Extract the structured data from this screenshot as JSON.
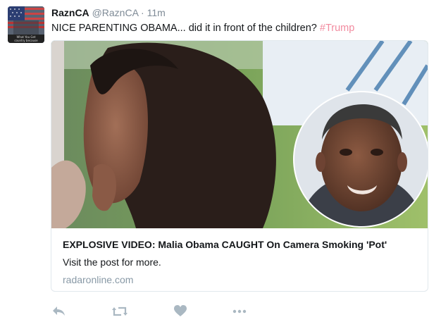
{
  "tweet": {
    "display_name": "RaznCA",
    "handle": "@RaznCA",
    "separator": "·",
    "time": "11m",
    "text": "NICE PARENTING OBAMA... did it in front of the children?",
    "hashtag": "#Trump",
    "avatar_caption": "What You Get ... country because"
  },
  "card": {
    "title": "EXPLOSIVE VIDEO: Malia Obama CAUGHT On Camera Smoking 'Pot'",
    "description": "Visit the post for more.",
    "domain": "radaronline.com"
  },
  "actions": {
    "icons": [
      "reply-icon",
      "retweet-icon",
      "like-icon",
      "more-icon"
    ]
  },
  "colors": {
    "accent": "#f28b9f",
    "muted": "#7e8a96",
    "icon": "#aab8c2",
    "border": "#e1e8ed"
  }
}
